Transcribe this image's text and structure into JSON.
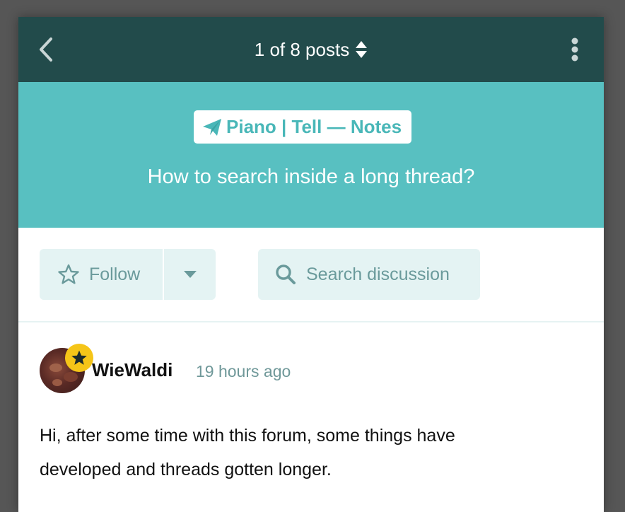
{
  "topbar": {
    "posts_label": "1 of 8 posts",
    "back_icon": "chevron-left-icon",
    "more_icon": "vertical-ellipsis-icon"
  },
  "hero": {
    "tag_label": "Piano | Tell — Notes",
    "tag_icon": "paper-plane-icon",
    "title": "How to search inside a long thread?"
  },
  "actions": {
    "follow_label": "Follow",
    "search_label": "Search discussion"
  },
  "post": {
    "author": "WieWaldi",
    "time": "19 hours ago",
    "body_lines": [
      "Hi, after some time with this forum, some things have",
      "developed and threads gotten longer."
    ]
  },
  "colors": {
    "topbar_bg": "#224b4b",
    "hero_bg": "#58c0c1",
    "button_bg": "#e4f3f3",
    "badge": "#f5c518"
  }
}
